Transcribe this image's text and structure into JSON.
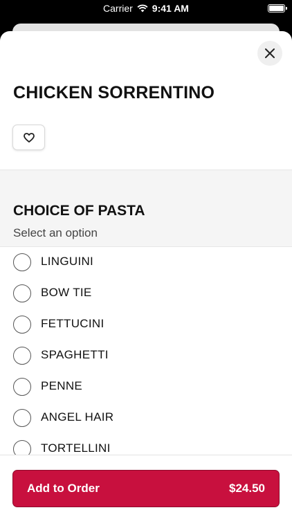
{
  "status_bar": {
    "carrier": "Carrier",
    "time": "9:41 AM"
  },
  "item": {
    "title": "CHICKEN SORRENTINO"
  },
  "section": {
    "title": "CHOICE OF PASTA",
    "subtitle": "Select an option",
    "options": [
      {
        "label": "LINGUINI"
      },
      {
        "label": "BOW TIE"
      },
      {
        "label": "FETTUCINI"
      },
      {
        "label": "SPAGHETTI"
      },
      {
        "label": "PENNE"
      },
      {
        "label": "ANGEL HAIR"
      },
      {
        "label": "TORTELLINI"
      }
    ]
  },
  "footer": {
    "button_label": "Add to Order",
    "price": "$24.50"
  },
  "colors": {
    "accent": "#c8103e"
  },
  "icons": [
    "wifi-icon",
    "battery-icon",
    "close-icon",
    "heart-icon",
    "radio-icon"
  ]
}
